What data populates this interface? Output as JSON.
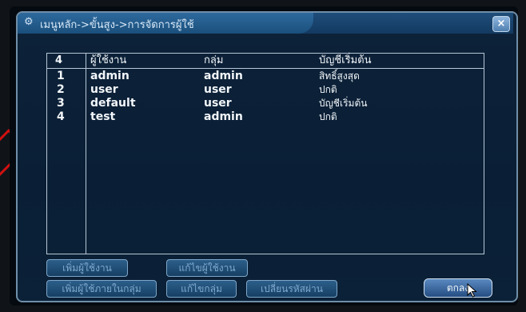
{
  "window": {
    "title": "เมนูหลัก->ขั้นสูง->การจัดการผู้ใช้",
    "close_label": "×"
  },
  "table": {
    "headers": [
      "4",
      "ผู้ใช้งาน",
      "กลุ่ม",
      "บัญชีเริ่มต้น"
    ],
    "rows": [
      [
        "1",
        "admin",
        "admin",
        "สิทธิ์สูงสุด"
      ],
      [
        "2",
        "user",
        "user",
        "ปกติ"
      ],
      [
        "3",
        "default",
        "user",
        "บัญชีเริ่มต้น"
      ],
      [
        "4",
        "test",
        "admin",
        "ปกติ"
      ]
    ]
  },
  "buttons": {
    "add_user": "เพิ่มผู้ใช้งาน",
    "edit_user": "แก้ไขผู้ใช้งาน",
    "add_group": "เพิ่มผู้ใช้ภายในกลุ่ม",
    "edit_group": "แก้ไขกลุ่ม",
    "change_password": "เปลี่ยนรหัสผ่าน",
    "ok": "ตกลง"
  }
}
